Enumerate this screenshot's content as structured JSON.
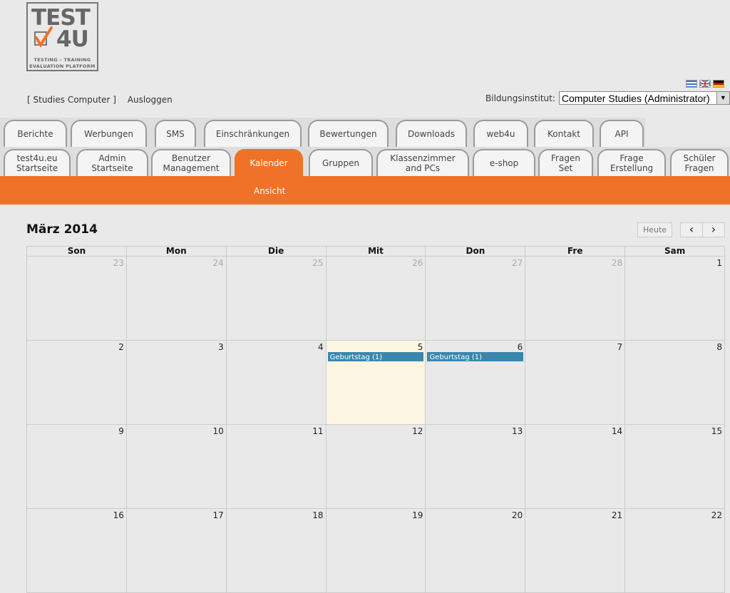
{
  "logo": {
    "line1": "TEST",
    "line2": "4U",
    "sub1": "TESTING  –  TRAINING",
    "sub2": "EVALUATION PLATFORM"
  },
  "user": {
    "name": "[ Studies Computer ]",
    "logout": "Ausloggen"
  },
  "institute": {
    "label": "Bildungsinstitut:",
    "value": "Computer Studies (Administrator)"
  },
  "tabs_row1": [
    "Berichte",
    "Werbungen",
    "SMS",
    "Einschränkungen",
    "Bewertungen",
    "Downloads",
    "web4u",
    "Kontakt",
    "API"
  ],
  "tabs_row2": [
    "test4u.eu\nStartseite",
    "Admin\nStartseite",
    "Benutzer\nManagement",
    "Kalender",
    "Gruppen",
    "Klassenzimmer\nand PCs",
    "e-shop",
    "Fragen\nSet",
    "Frage\nErstellung",
    "Schüler\nFragen"
  ],
  "subnav": {
    "item": "Ansicht"
  },
  "calendar": {
    "title": "März 2014",
    "today_button": "Heute",
    "prev": "‹",
    "next": "›",
    "weekdays": [
      "Son",
      "Mon",
      "Die",
      "Mit",
      "Don",
      "Fre",
      "Sam"
    ],
    "weeks": [
      [
        {
          "d": "23",
          "o": true
        },
        {
          "d": "24",
          "o": true
        },
        {
          "d": "25",
          "o": true
        },
        {
          "d": "26",
          "o": true
        },
        {
          "d": "27",
          "o": true
        },
        {
          "d": "28",
          "o": true
        },
        {
          "d": "1"
        }
      ],
      [
        {
          "d": "2"
        },
        {
          "d": "3"
        },
        {
          "d": "4"
        },
        {
          "d": "5",
          "today": true,
          "event": "Geburtstag (1)"
        },
        {
          "d": "6",
          "event": "Geburtstag (1)"
        },
        {
          "d": "7"
        },
        {
          "d": "8"
        }
      ],
      [
        {
          "d": "9"
        },
        {
          "d": "10"
        },
        {
          "d": "11"
        },
        {
          "d": "12"
        },
        {
          "d": "13"
        },
        {
          "d": "14"
        },
        {
          "d": "15"
        }
      ],
      [
        {
          "d": "16"
        },
        {
          "d": "17"
        },
        {
          "d": "18"
        },
        {
          "d": "19"
        },
        {
          "d": "20"
        },
        {
          "d": "21"
        },
        {
          "d": "22"
        }
      ]
    ]
  },
  "colors": {
    "accent": "#f07228",
    "event": "#3a87ad",
    "today": "#fcf6e2"
  }
}
